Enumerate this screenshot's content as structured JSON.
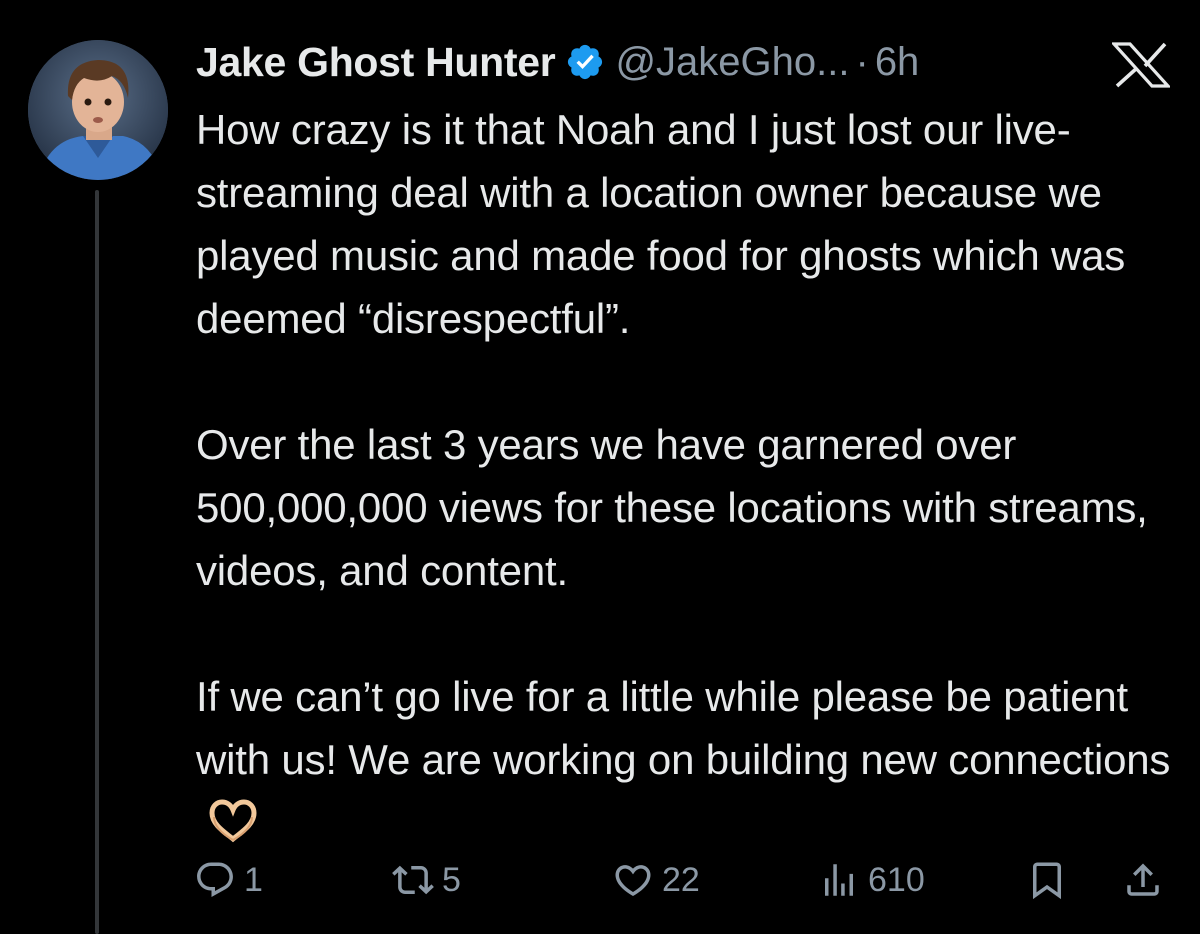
{
  "author": {
    "display_name": "Jake Ghost Hunter",
    "handle": "@JakeGho...",
    "separator": "·",
    "time": "6h",
    "verified": true,
    "verified_badge_color": "#1d9bf0",
    "avatar_icon": "profile-photo"
  },
  "platform": {
    "logo_icon": "x-logo-icon"
  },
  "tweet": {
    "paragraphs": [
      "How crazy is it that Noah and I just lost our live-streaming deal with a location owner because we played music and made food for ghosts which was deemed “disrespectful”.",
      "Over the last 3 years we have garnered over 500,000,000 views for these locations with streams, videos, and content.",
      "If we can’t go live for a little while please be patient with us! We are working on building new connections"
    ],
    "trailing_emoji_icon": "heart-hands-emoji"
  },
  "actions": {
    "reply": {
      "count": "1",
      "icon": "reply-icon"
    },
    "retweet": {
      "count": "5",
      "icon": "retweet-icon"
    },
    "like": {
      "count": "22",
      "icon": "heart-icon"
    },
    "views": {
      "count": "610",
      "icon": "views-icon"
    },
    "bookmark": {
      "icon": "bookmark-icon"
    },
    "share": {
      "icon": "share-icon"
    }
  },
  "colors": {
    "background": "#000000",
    "text_primary": "#e7e9ea",
    "text_secondary": "#8b98a5",
    "thread_line": "#333639"
  }
}
